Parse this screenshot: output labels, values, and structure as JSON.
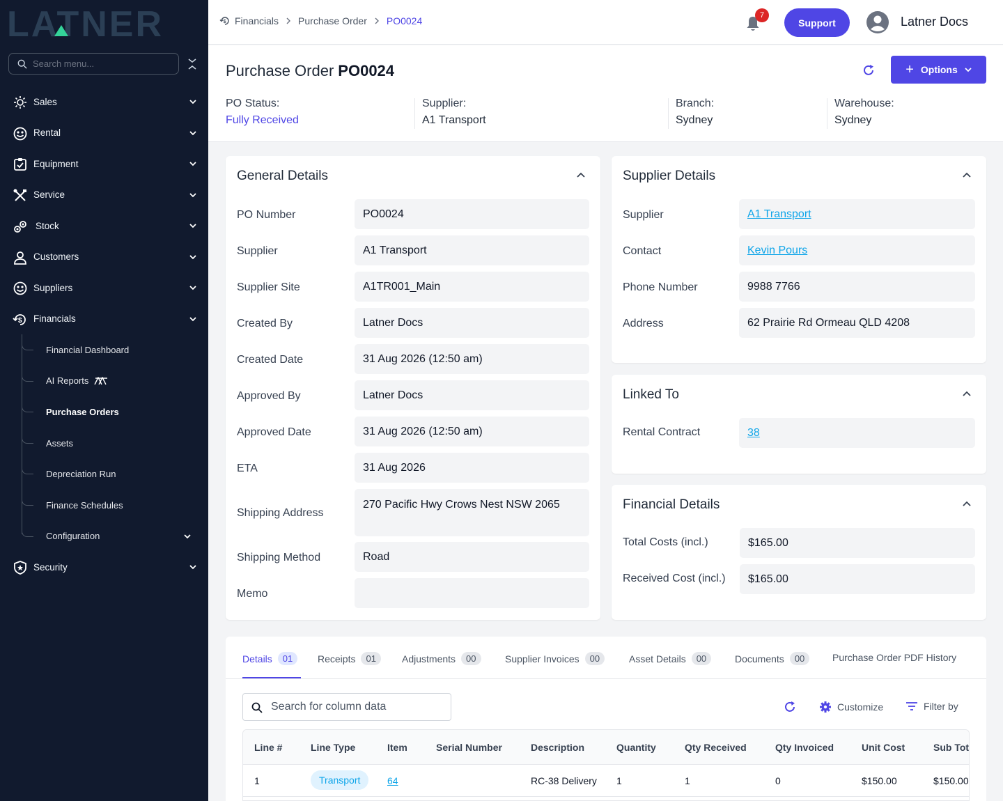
{
  "sidebar": {
    "logo_text": "LATNER",
    "search_placeholder": "Search menu...",
    "items": [
      {
        "label": "Sales",
        "icon": "sales-icon"
      },
      {
        "label": "Rental",
        "icon": "rental-icon"
      },
      {
        "label": "Equipment",
        "icon": "equipment-icon"
      },
      {
        "label": "Service",
        "icon": "service-icon"
      },
      {
        "label": "Stock",
        "icon": "stock-icon"
      },
      {
        "label": "Customers",
        "icon": "customers-icon"
      },
      {
        "label": "Suppliers",
        "icon": "suppliers-icon"
      },
      {
        "label": "Financials",
        "icon": "financials-icon"
      }
    ],
    "financials_sub": [
      {
        "label": "Financial Dashboard"
      },
      {
        "label": "AI Reports"
      },
      {
        "label": "Purchase Orders"
      },
      {
        "label": "Assets"
      },
      {
        "label": "Depreciation Run"
      },
      {
        "label": "Finance Schedules"
      },
      {
        "label": "Configuration"
      }
    ],
    "security": {
      "label": "Security",
      "icon": "shield-icon"
    }
  },
  "topbar": {
    "breadcrumb": [
      "Financials",
      "Purchase Order",
      "PO0024"
    ],
    "notification_count": "7",
    "support_label": "Support",
    "user_name": "Latner Docs"
  },
  "header": {
    "title_prefix": "Purchase Order",
    "title_id": "PO0024",
    "options_label": "Options",
    "fields": [
      {
        "label": "PO Status:",
        "value": "Fully Received"
      },
      {
        "label": "Supplier:",
        "value": "A1 Transport"
      },
      {
        "label": "Branch:",
        "value": "Sydney"
      },
      {
        "label": "Warehouse:",
        "value": "Sydney"
      }
    ]
  },
  "general": {
    "title": "General Details",
    "rows": [
      {
        "label": "PO Number",
        "value": "PO0024"
      },
      {
        "label": "Supplier",
        "value": "A1 Transport"
      },
      {
        "label": "Supplier Site",
        "value": "A1TR001_Main"
      },
      {
        "label": "Created By",
        "value": "Latner Docs"
      },
      {
        "label": "Created Date",
        "value": "31 Aug 2026 (12:50 am)"
      },
      {
        "label": "Approved By",
        "value": "Latner Docs"
      },
      {
        "label": "Approved Date",
        "value": "31 Aug 2026 (12:50 am)"
      },
      {
        "label": "ETA",
        "value": "31 Aug 2026"
      },
      {
        "label": "Shipping Address",
        "value": "270 Pacific Hwy Crows Nest NSW 2065"
      },
      {
        "label": "Shipping Method",
        "value": "Road"
      },
      {
        "label": "Memo",
        "value": ""
      }
    ]
  },
  "supplier": {
    "title": "Supplier Details",
    "rows": [
      {
        "label": "Supplier",
        "value": "A1 Transport"
      },
      {
        "label": "Contact",
        "value": "Kevin Pours"
      },
      {
        "label": "Phone Number",
        "value": "9988 7766"
      },
      {
        "label": "Address",
        "value": "62 Prairie Rd Ormeau QLD 4208"
      }
    ]
  },
  "linked": {
    "title": "Linked To",
    "rows": [
      {
        "label": "Rental Contract",
        "value": "38"
      }
    ]
  },
  "financial": {
    "title": "Financial Details",
    "rows": [
      {
        "label": "Total Costs (incl.)",
        "value": "$165.00"
      },
      {
        "label": "Received Cost (incl.)",
        "value": "$165.00"
      }
    ]
  },
  "tabs": [
    {
      "label": "Details",
      "count": "01"
    },
    {
      "label": "Receipts",
      "count": "01"
    },
    {
      "label": "Adjustments",
      "count": "00"
    },
    {
      "label": "Supplier Invoices",
      "count": "00"
    },
    {
      "label": "Asset Details",
      "count": "00"
    },
    {
      "label": "Documents",
      "count": "00"
    },
    {
      "label": "Purchase Order PDF History",
      "count": ""
    }
  ],
  "table": {
    "search_placeholder": "Search for column data",
    "customize_label": "Customize",
    "filter_label": "Filter by",
    "columns": [
      "Line #",
      "Line Type",
      "Item",
      "Serial Number",
      "Description",
      "Quantity",
      "Qty Received",
      "Qty Invoiced",
      "Unit Cost",
      "Sub Tot"
    ],
    "rows": [
      {
        "line": "1",
        "type": "Transport",
        "item": "64",
        "serial": "",
        "description": "RC-38 Delivery",
        "quantity": "1",
        "received": "1",
        "invoiced": "0",
        "unit_cost": "$150.00",
        "sub_total": "$150.00"
      }
    ]
  },
  "colors": {
    "accent": "#4f46e5",
    "sidebar_bg": "#111a2e",
    "link": "#0ea5e9",
    "badge": "#dc2626"
  }
}
